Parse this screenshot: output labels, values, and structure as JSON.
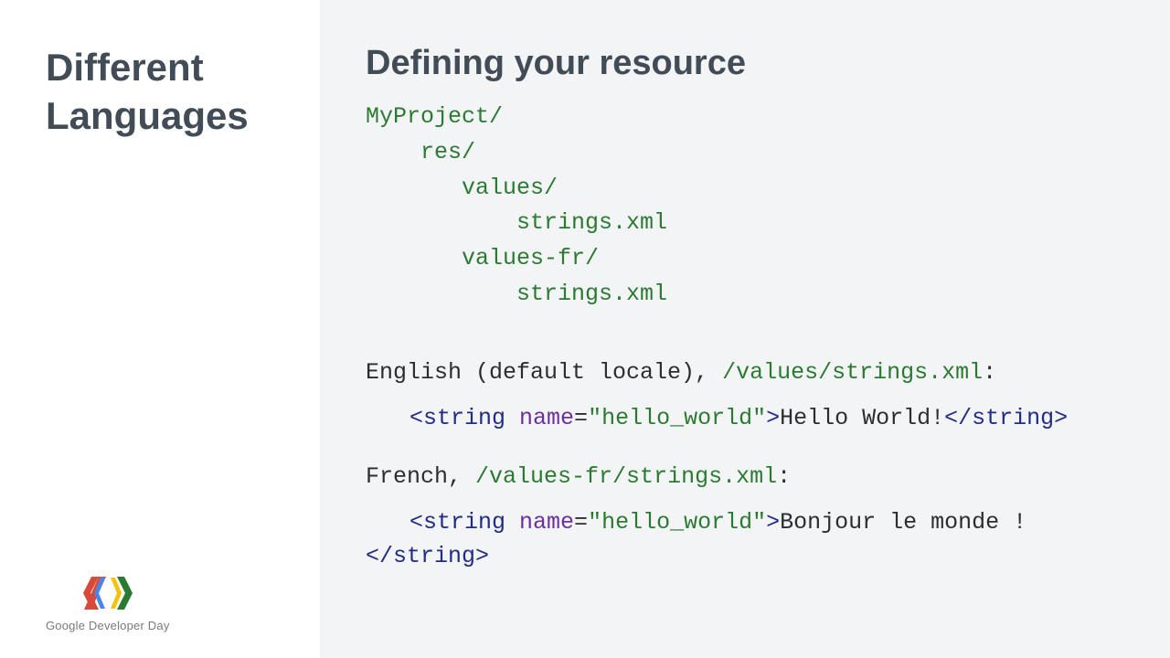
{
  "sidebar": {
    "title_line1": "Different",
    "title_line2": "Languages",
    "logo_caption": "Google Developer Day"
  },
  "main": {
    "title": "Defining your resource",
    "tree": {
      "l0": "MyProject/",
      "l1": "res/",
      "l2a": "values/",
      "l3a": "strings.xml",
      "l2b": "values-fr/",
      "l3b": "strings.xml"
    },
    "english": {
      "label_prefix": "English (default locale), ",
      "label_path": "/values/strings.xml",
      "label_suffix": ":",
      "tag_open_lt": "<",
      "tag_name": "string",
      "attr_name": " name",
      "attr_eq": "=",
      "attr_val": "\"hello_world\"",
      "tag_open_gt": ">",
      "content": "Hello World!",
      "tag_close": "</string>"
    },
    "french": {
      "label_prefix": "French, ",
      "label_path": "/values-fr/strings.xml",
      "label_suffix": ":",
      "tag_open_lt": "<",
      "tag_name": "string",
      "attr_name": " name",
      "attr_eq": "=",
      "attr_val": "\"hello_world\"",
      "tag_open_gt": ">",
      "content": "Bonjour le monde !",
      "tag_close": "</string>"
    }
  }
}
